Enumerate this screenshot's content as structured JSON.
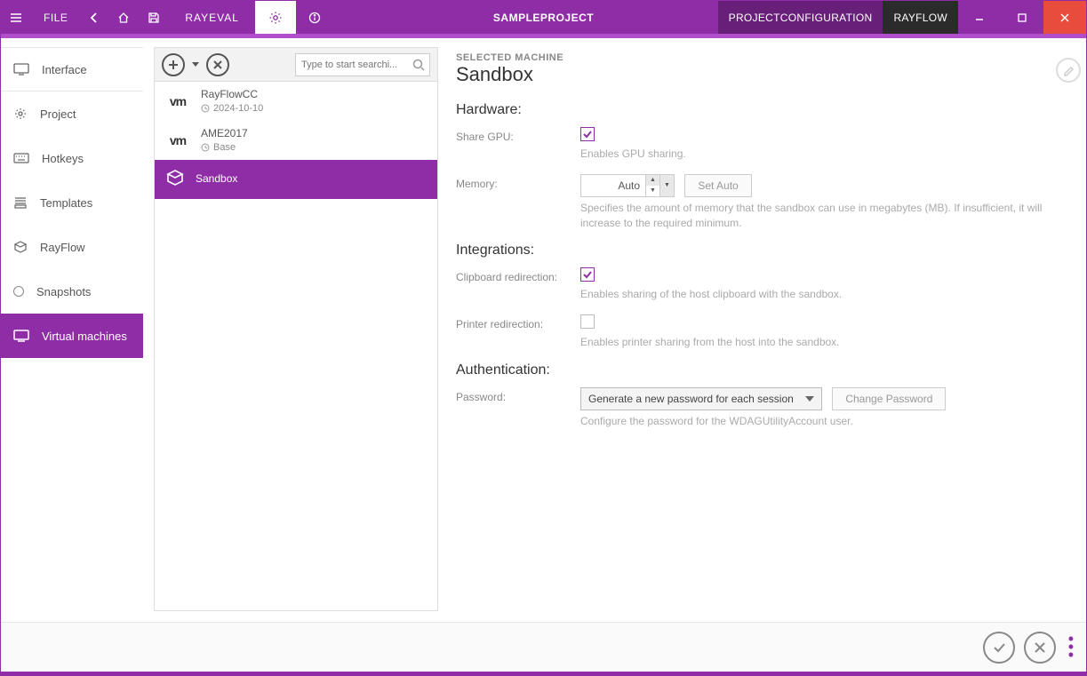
{
  "titlebar": {
    "file": "FILE",
    "brand": "RAYEVAL",
    "project": "SAMPLEPROJECT",
    "tabs": {
      "config": "PROJECTCONFIGURATION",
      "rayflow": "RAYFLOW"
    }
  },
  "leftnav": {
    "items": [
      {
        "label": "Interface"
      },
      {
        "label": "Project"
      },
      {
        "label": "Hotkeys"
      },
      {
        "label": "Templates"
      },
      {
        "label": "RayFlow"
      },
      {
        "label": "Snapshots"
      },
      {
        "label": "Virtual machines"
      }
    ]
  },
  "midpanel": {
    "search_placeholder": "Type to start searchi...",
    "items": [
      {
        "name": "RayFlowCC",
        "sub": "2024-10-10",
        "logo": "vm",
        "subicon": "clock"
      },
      {
        "name": "AME2017",
        "sub": "Base",
        "logo": "vm",
        "subicon": "clock"
      },
      {
        "name": "Sandbox",
        "logo": "box",
        "selected": true
      }
    ]
  },
  "detail": {
    "eyebrow": "SELECTED MACHINE",
    "title": "Sandbox",
    "sections": {
      "hardware": {
        "heading": "Hardware:",
        "share_gpu": {
          "label": "Share GPU:",
          "checked": true,
          "hint": "Enables GPU sharing."
        },
        "memory": {
          "label": "Memory:",
          "value": "Auto",
          "button": "Set Auto",
          "hint": "Specifies the amount of memory that the sandbox can use in megabytes (MB). If insufficient, it will increase to the required minimum."
        }
      },
      "integrations": {
        "heading": "Integrations:",
        "clipboard": {
          "label": "Clipboard redirection:",
          "checked": true,
          "hint": "Enables sharing of the host clipboard with the sandbox."
        },
        "printer": {
          "label": "Printer redirection:",
          "checked": false,
          "hint": "Enables printer sharing from the host into the sandbox."
        }
      },
      "auth": {
        "heading": "Authentication:",
        "password": {
          "label": "Password:",
          "select": "Generate a new password for each session",
          "button": "Change Password",
          "hint": "Configure the password for the WDAGUtilityAccount user."
        }
      }
    }
  }
}
